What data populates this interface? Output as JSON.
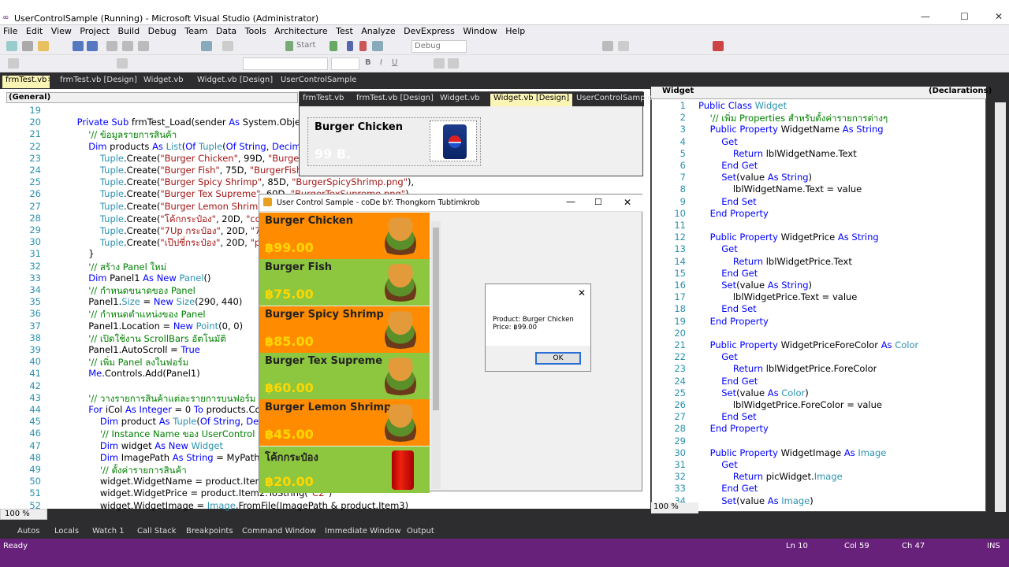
{
  "window": {
    "title": "UserControlSample (Running) - Microsoft Visual Studio (Administrator)"
  },
  "menu": [
    "File",
    "Edit",
    "View",
    "Project",
    "Build",
    "Debug",
    "Team",
    "Data",
    "Tools",
    "Architecture",
    "Test",
    "Analyze",
    "DevExpress",
    "Window",
    "Help"
  ],
  "toolbar": {
    "start_label": "Start",
    "config": "Debug"
  },
  "doc_tabs": [
    "frmTest.vb",
    "frmTest.vb [Design]",
    "Widget.vb",
    "Widget.vb [Design]",
    "UserControlSample"
  ],
  "editor1": {
    "scope": "(General)",
    "zoom": "100 %",
    "lines": [
      {
        "n": "19",
        "code": ""
      },
      {
        "n": "20",
        "code": "    Private Sub frmTest_Load(sender As System.Object, e A"
      },
      {
        "n": "21",
        "code": "        '// ข้อมูลรายการสินค้า"
      },
      {
        "n": "22",
        "code": "        Dim products As List(Of Tuple(Of String, Decimal, Stri"
      },
      {
        "n": "23",
        "code": "            Tuple.Create(\"Burger Chicken\", 99D, \"BurgerChick"
      },
      {
        "n": "24",
        "code": "            Tuple.Create(\"Burger Fish\", 75D, \"BurgerFish.png\""
      },
      {
        "n": "25",
        "code": "            Tuple.Create(\"Burger Spicy Shrimp\", 85D, \"BurgerSpicyShrimp.png\"),"
      },
      {
        "n": "26",
        "code": "            Tuple.Create(\"Burger Tex Supreme\", 60D, \"BurgerTexSupreme.png\"),"
      },
      {
        "n": "27",
        "code": "            Tuple.Create(\"Burger Lemon Shrimp\", 45"
      },
      {
        "n": "28",
        "code": "            Tuple.Create(\"โค้กกระป๋อง\", 20D, \"cokec"
      },
      {
        "n": "29",
        "code": "            Tuple.Create(\"7Up กระป๋อง\", 20D, \"7upc"
      },
      {
        "n": "30",
        "code": "            Tuple.Create(\"เป๊ปซี่กระป๋อง\", 20D, \"peps"
      },
      {
        "n": "31",
        "code": "        }"
      },
      {
        "n": "32",
        "code": "        '// สร้าง Panel ใหม่"
      },
      {
        "n": "33",
        "code": "        Dim Panel1 As New Panel()"
      },
      {
        "n": "34",
        "code": "        '// กำหนดขนาดของ Panel"
      },
      {
        "n": "35",
        "code": "        Panel1.Size = New Size(290, 440)"
      },
      {
        "n": "36",
        "code": "        '// กำหนดตำแหน่งของ Panel"
      },
      {
        "n": "37",
        "code": "        Panel1.Location = New Point(0, 0)"
      },
      {
        "n": "38",
        "code": "        '// เปิดใช้งาน ScrollBars อัตโนมัติ"
      },
      {
        "n": "39",
        "code": "        Panel1.AutoScroll = True"
      },
      {
        "n": "40",
        "code": "        '// เพิ่ม Panel ลงในฟอร์ม"
      },
      {
        "n": "41",
        "code": "        Me.Controls.Add(Panel1)"
      },
      {
        "n": "42",
        "code": ""
      },
      {
        "n": "43",
        "code": "        '// วางรายการสินค้าแต่ละรายการบนฟอร์ม (อยู่ภ"
      },
      {
        "n": "44",
        "code": "        For iCol As Integer = 0 To products.Count -"
      },
      {
        "n": "45",
        "code": "            Dim product As Tuple(Of String, Decimal"
      },
      {
        "n": "46",
        "code": "            '// Instance Name ของ UserControl (Pro"
      },
      {
        "n": "47",
        "code": "            Dim widget As New Widget"
      },
      {
        "n": "48",
        "code": "            Dim ImagePath As String = MyPath(App"
      },
      {
        "n": "49",
        "code": "            '// ตั้งค่ารายการสินค้า"
      },
      {
        "n": "50",
        "code": "            widget.WidgetName = product.Item1"
      },
      {
        "n": "51",
        "code": "            widget.WidgetPrice = product.Item2.ToString(\"C2\")"
      },
      {
        "n": "52",
        "code": "            widget.WidgetImage = Image.FromFile(ImagePath & product.Item3)"
      }
    ]
  },
  "editor2": {
    "class_combo": "Widget",
    "member_combo": "(Declarations)",
    "zoom": "100 %",
    "lines": [
      {
        "n": "1",
        "code": "Public Class Widget"
      },
      {
        "n": "2",
        "code": "    '// เพิ่ม Properties สำหรับตั้งค่ารายการต่างๆ"
      },
      {
        "n": "3",
        "code": "    Public Property WidgetName As String"
      },
      {
        "n": "4",
        "code": "        Get"
      },
      {
        "n": "5",
        "code": "            Return lblWidgetName.Text"
      },
      {
        "n": "6",
        "code": "        End Get"
      },
      {
        "n": "7",
        "code": "        Set(value As String)"
      },
      {
        "n": "8",
        "code": "            lblWidgetName.Text = value"
      },
      {
        "n": "9",
        "code": "        End Set"
      },
      {
        "n": "10",
        "code": "    End Property"
      },
      {
        "n": "11",
        "code": ""
      },
      {
        "n": "12",
        "code": "    Public Property WidgetPrice As String"
      },
      {
        "n": "13",
        "code": "        Get"
      },
      {
        "n": "14",
        "code": "            Return lblWidgetPrice.Text"
      },
      {
        "n": "15",
        "code": "        End Get"
      },
      {
        "n": "16",
        "code": "        Set(value As String)"
      },
      {
        "n": "17",
        "code": "            lblWidgetPrice.Text = value"
      },
      {
        "n": "18",
        "code": "        End Set"
      },
      {
        "n": "19",
        "code": "    End Property"
      },
      {
        "n": "20",
        "code": ""
      },
      {
        "n": "21",
        "code": "    Public Property WidgetPriceForeColor As Color"
      },
      {
        "n": "22",
        "code": "        Get"
      },
      {
        "n": "23",
        "code": "            Return lblWidgetPrice.ForeColor"
      },
      {
        "n": "24",
        "code": "        End Get"
      },
      {
        "n": "25",
        "code": "        Set(value As Color)"
      },
      {
        "n": "26",
        "code": "            lblWidgetPrice.ForeColor = value"
      },
      {
        "n": "27",
        "code": "        End Set"
      },
      {
        "n": "28",
        "code": "    End Property"
      },
      {
        "n": "29",
        "code": ""
      },
      {
        "n": "30",
        "code": "    Public Property WidgetImage As Image"
      },
      {
        "n": "31",
        "code": "        Get"
      },
      {
        "n": "32",
        "code": "            Return picWidget.Image"
      },
      {
        "n": "33",
        "code": "        End Get"
      },
      {
        "n": "34",
        "code": "        Set(value As Image)"
      }
    ]
  },
  "designer": {
    "tabs": [
      "frmTest.vb",
      "frmTest.vb [Design]",
      "Widget.vb",
      "Widget.vb [Design]",
      "UserControlSample"
    ],
    "widget_name": "Burger Chicken",
    "widget_price": "99 B."
  },
  "popup": {
    "title": "User Control Sample - coDe bY: Thongkorn Tubtimkrob",
    "items": [
      {
        "name": "Burger Chicken",
        "price": "฿99.00",
        "bg": "#ff8c00",
        "img": "burger"
      },
      {
        "name": "Burger Fish",
        "price": "฿75.00",
        "bg": "#8dc63f",
        "img": "burger"
      },
      {
        "name": "Burger Spicy Shrimp",
        "price": "฿85.00",
        "bg": "#ff8c00",
        "img": "burger"
      },
      {
        "name": "Burger Tex Supreme",
        "price": "฿60.00",
        "bg": "#8dc63f",
        "img": "burger"
      },
      {
        "name": "Burger Lemon Shrimp",
        "price": "฿45.00",
        "bg": "#ff8c00",
        "img": "burger"
      },
      {
        "name": "โค้กกระป๋อง",
        "price": "฿20.00",
        "bg": "#8dc63f",
        "img": "coke"
      }
    ]
  },
  "msgbox": {
    "line1": "Product: Burger Chicken",
    "line2": "Price: ฿99.00",
    "ok": "OK"
  },
  "bottom_tabs": [
    "Autos",
    "Locals",
    "Watch 1",
    "Call Stack",
    "Breakpoints",
    "Command Window",
    "Immediate Window",
    "Output"
  ],
  "status": {
    "ready": "Ready",
    "ln": "Ln 10",
    "col": "Col 59",
    "ch": "Ch 47",
    "mode": "INS"
  }
}
